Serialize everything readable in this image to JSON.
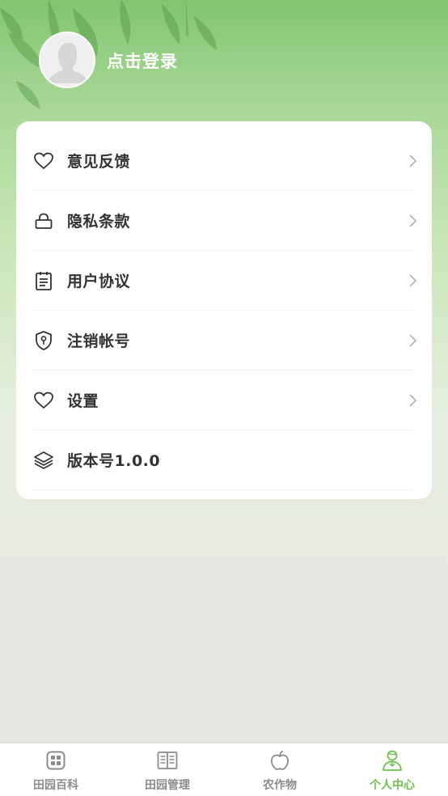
{
  "header": {
    "login_label": "点击登录",
    "avatar": "default-user-avatar"
  },
  "menu": {
    "items": [
      {
        "label": "意见反馈",
        "icon": "heart-icon",
        "has_arrow": true
      },
      {
        "label": "隐私条款",
        "icon": "lock-icon",
        "has_arrow": true
      },
      {
        "label": "用户协议",
        "icon": "clipboard-icon",
        "has_arrow": true
      },
      {
        "label": "注销帐号",
        "icon": "shield-key-icon",
        "has_arrow": true
      },
      {
        "label": "设置",
        "icon": "heart-icon",
        "has_arrow": true
      },
      {
        "label": "版本号1.0.0",
        "icon": "layers-icon",
        "has_arrow": false
      }
    ]
  },
  "tabbar": {
    "tabs": [
      {
        "label": "田园百科",
        "icon": "grid-square-icon",
        "active": false
      },
      {
        "label": "田园管理",
        "icon": "book-icon",
        "active": false
      },
      {
        "label": "农作物",
        "icon": "apple-icon",
        "active": false
      },
      {
        "label": "个人中心",
        "icon": "person-icon",
        "active": true
      }
    ]
  },
  "colors": {
    "accent": "#6cc24a",
    "header_green": "#7fc66e",
    "inactive": "#8c8c8c",
    "text": "#333333"
  }
}
